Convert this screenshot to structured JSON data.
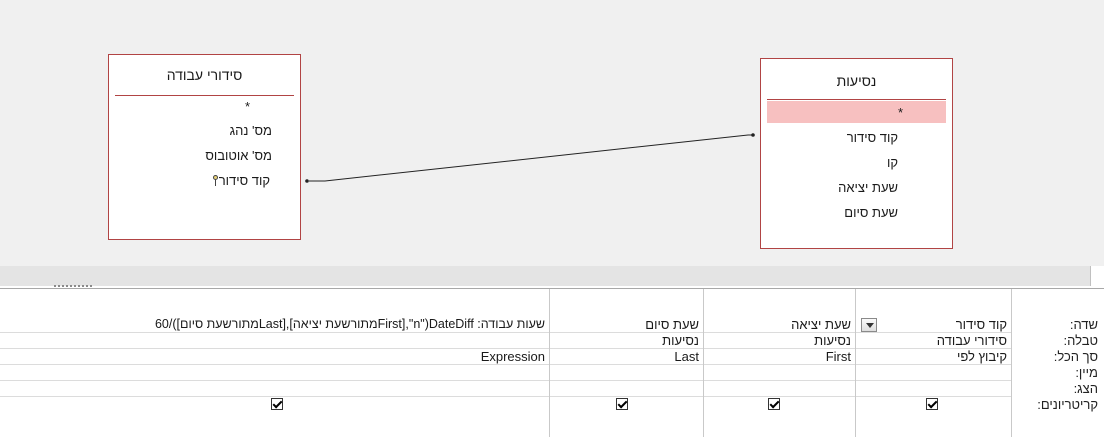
{
  "tables": {
    "left": {
      "title": "סידורי עבודה",
      "star": "*",
      "fields": [
        "מס' נהג",
        "מס' אוטובוס",
        "קוד סידור"
      ]
    },
    "right": {
      "title": "נסיעות",
      "star": "*",
      "fields": [
        "קוד סידור",
        "קו",
        "שעת יציאה",
        "שעת סיום"
      ]
    }
  },
  "grid": {
    "row_labels": [
      "שדה:",
      "טבלה:",
      "סך הכל:",
      "מיין:",
      "הצג:",
      "קריטריונים:"
    ],
    "columns": [
      {
        "field": "קוד סידור",
        "table": "סידורי עבודה",
        "total": "קיבוץ לפי",
        "sort": "",
        "show": true,
        "criteria": ""
      },
      {
        "field": "שעת יציאה",
        "table": "נסיעות",
        "total": "First",
        "sort": "",
        "show": true,
        "criteria": ""
      },
      {
        "field": "שעת סיום",
        "table": "נסיעות",
        "total": "Last",
        "sort": "",
        "show": true,
        "criteria": ""
      },
      {
        "field": "שעות עבודה: DateDiff(\"n\",[Firstמתורשעת יציאה],[Lastמתורשעת סיום])/60",
        "table": "",
        "total": "Expression",
        "sort": "",
        "show": true,
        "criteria": ""
      }
    ]
  },
  "colors": {
    "border": "#b14444",
    "selection": "#f7c0c0",
    "pane": "#f0f0f0"
  },
  "icons": {
    "primary_key": "key-icon",
    "dropdown": "chevron-down-icon",
    "checkbox": "checkbox-checked-icon"
  }
}
